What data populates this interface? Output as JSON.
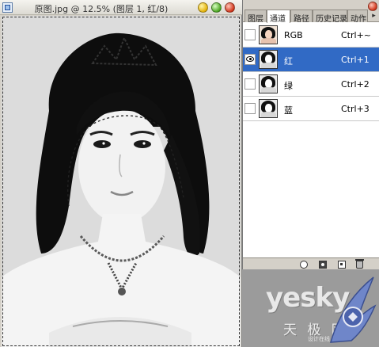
{
  "document": {
    "title": "原图.jpg @ 12.5% (图层 1, 红/8)"
  },
  "panel": {
    "tabs": [
      {
        "label": "图层",
        "active": false
      },
      {
        "label": "通道",
        "active": true
      },
      {
        "label": "路径",
        "active": false
      },
      {
        "label": "历史记录",
        "active": false
      },
      {
        "label": "动作",
        "active": false
      }
    ],
    "menu_icon": "triangle-menu-icon",
    "channels": [
      {
        "name": "RGB",
        "shortcut": "Ctrl+~",
        "visible": false,
        "selected": false,
        "thumb": "color"
      },
      {
        "name": "红",
        "shortcut": "Ctrl+1",
        "visible": true,
        "selected": true,
        "thumb": "gray"
      },
      {
        "name": "绿",
        "shortcut": "Ctrl+2",
        "visible": false,
        "selected": false,
        "thumb": "gray"
      },
      {
        "name": "蓝",
        "shortcut": "Ctrl+3",
        "visible": false,
        "selected": false,
        "thumb": "gray"
      }
    ],
    "footer_icons": [
      "load-selection-icon",
      "save-selection-icon",
      "new-channel-icon",
      "delete-channel-icon"
    ],
    "selection_color": "#316ac5"
  },
  "watermark": {
    "logo": "yesky",
    "subtitle": "天 极 网",
    "badge": "设计在线"
  }
}
